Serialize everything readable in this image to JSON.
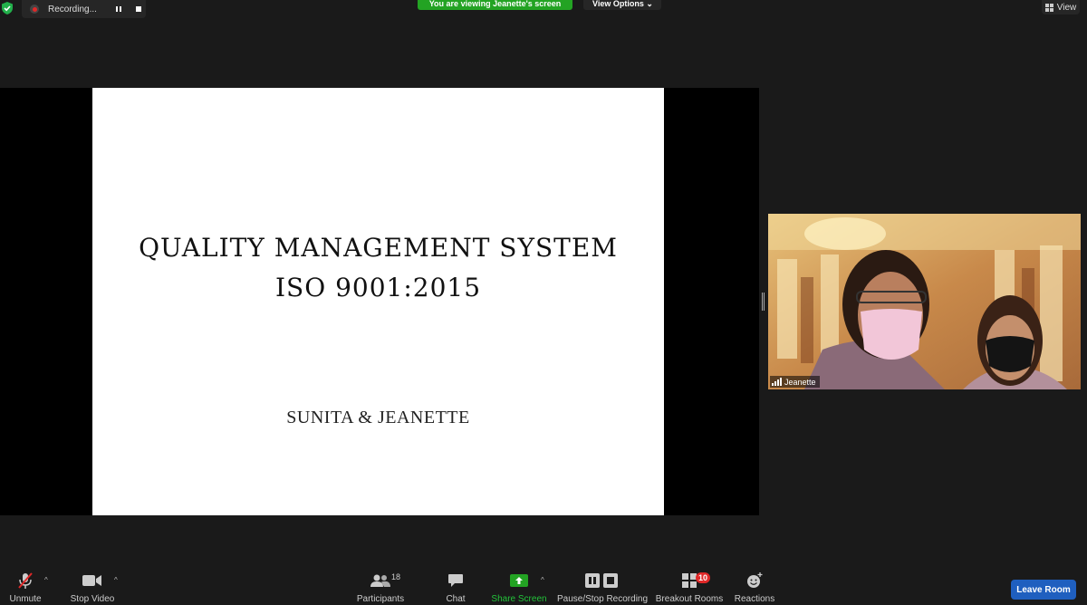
{
  "recording": {
    "label": "Recording..."
  },
  "banner": {
    "text": "You are viewing Jeanette's screen"
  },
  "view_options": {
    "label": "View Options",
    "chevron": "⌄"
  },
  "view_button": {
    "label": "View"
  },
  "slide": {
    "title_line1": "QUALITY MANAGEMENT SYSTEM",
    "title_line2": "ISO 9001:2015",
    "subtitle": "SUNITA & JEANETTE"
  },
  "video": {
    "participant_name": "Jeanette"
  },
  "toolbar": {
    "unmute": "Unmute",
    "stop_video": "Stop Video",
    "participants": "Participants",
    "participants_count": "18",
    "chat": "Chat",
    "share_screen": "Share Screen",
    "pause_stop_recording": "Pause/Stop Recording",
    "breakout_rooms": "Breakout Rooms",
    "breakout_rooms_badge": "10",
    "reactions": "Reactions",
    "leave_room": "Leave Room",
    "caret": "^"
  },
  "colors": {
    "accent_green": "#23a323",
    "leave_blue": "#1f5fbf",
    "badge_red": "#e02828"
  }
}
